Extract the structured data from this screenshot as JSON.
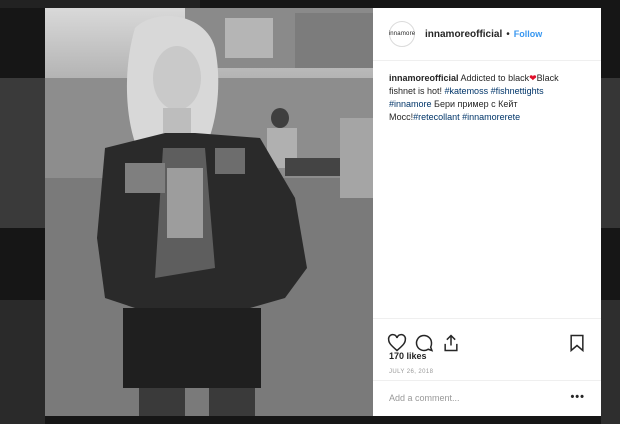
{
  "post": {
    "avatar_text": "innamore",
    "username": "innamoreofficial",
    "separator": "•",
    "follow_label": "Follow",
    "caption": {
      "username": "innamoreofficial",
      "text_1": "Addicted to black",
      "heart": "❤",
      "text_2": "Black fishnet is hot!",
      "tag_1": "#katemoss",
      "tag_2": "#fishnettights",
      "tag_3": "#innamore",
      "text_3": "Бери пример с Кейт Мосс!",
      "tag_4": "#retecollant",
      "tag_5": "#innamorerete"
    },
    "likes": "170 likes",
    "date": "JULY 26, 2018",
    "comment_placeholder": "Add a comment...",
    "more_label": "•••"
  },
  "colors": {
    "link": "#3897f0",
    "hashtag": "#003569",
    "heart": "#e0102b"
  },
  "icons": [
    "like-heart-icon",
    "comment-icon",
    "share-icon",
    "bookmark-icon"
  ]
}
